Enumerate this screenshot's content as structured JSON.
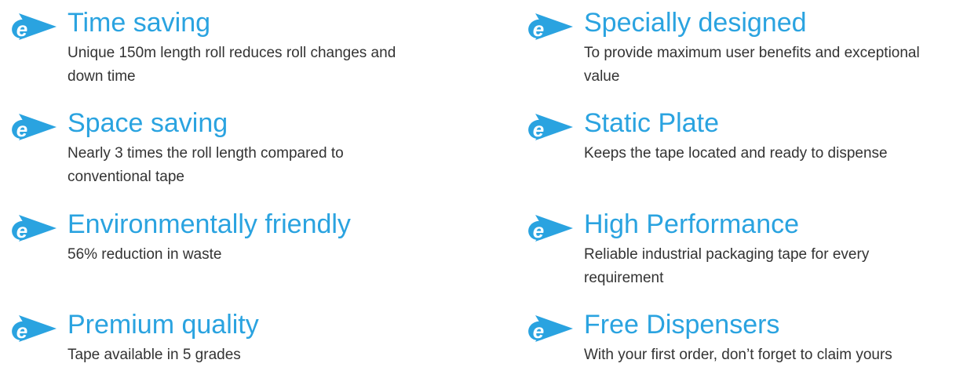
{
  "brand": {
    "accent_color": "#2aa3e0",
    "text_color": "#333333",
    "icon": "e-arrow-icon"
  },
  "features": [
    {
      "title": "Time saving",
      "description": "Unique 150m length roll reduces roll changes and down time"
    },
    {
      "title": "Space saving",
      "description": "Nearly 3 times the roll length compared to conventional tape"
    },
    {
      "title": "Environmentally friendly",
      "description": "56% reduction in waste"
    },
    {
      "title": "Premium quality",
      "description": "Tape available in 5 grades"
    },
    {
      "title": "Specially designed",
      "description": "To provide maximum user benefits and exceptional value"
    },
    {
      "title": "Static Plate",
      "description": "Keeps the tape located and ready to dispense"
    },
    {
      "title": "High Performance",
      "description": "Reliable industrial packaging tape for every requirement"
    },
    {
      "title": "Free Dispensers",
      "description": "With your first order, don’t forget to claim yours"
    }
  ]
}
